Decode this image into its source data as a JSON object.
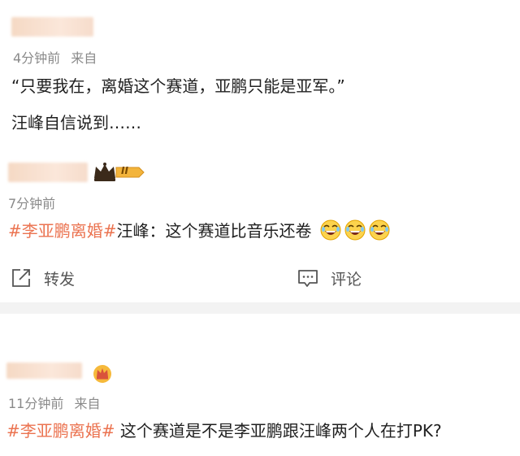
{
  "colors": {
    "topic": "#eb7350",
    "meta": "#8a8a8a",
    "divider": "#f3f3f3"
  },
  "comment1": {
    "time": "4分钟前",
    "source": "来自",
    "quote": "“只要我在，离婚这个赛道，亚鹏只能是亚军。”",
    "line2": "汪峰自信说到……"
  },
  "comment2": {
    "badge": {
      "icon": "crown-icon",
      "level": "II"
    },
    "time": "7分钟前",
    "topic": "#李亚鹏离婚#",
    "text": "汪峰：这个赛道比音乐还卷",
    "emojis": [
      "laugh-cry-icon",
      "laugh-cry-icon",
      "laugh-cry-icon"
    ]
  },
  "actions": {
    "repost": "转发",
    "comment": "评论"
  },
  "comment3": {
    "badge_icon": "crown-badge-icon",
    "time": "11分钟前",
    "source": "来自",
    "topic": "#李亚鹏离婚#",
    "text": " 这个赛道是不是李亚鹏跟汪峰两个人在打PK?"
  }
}
